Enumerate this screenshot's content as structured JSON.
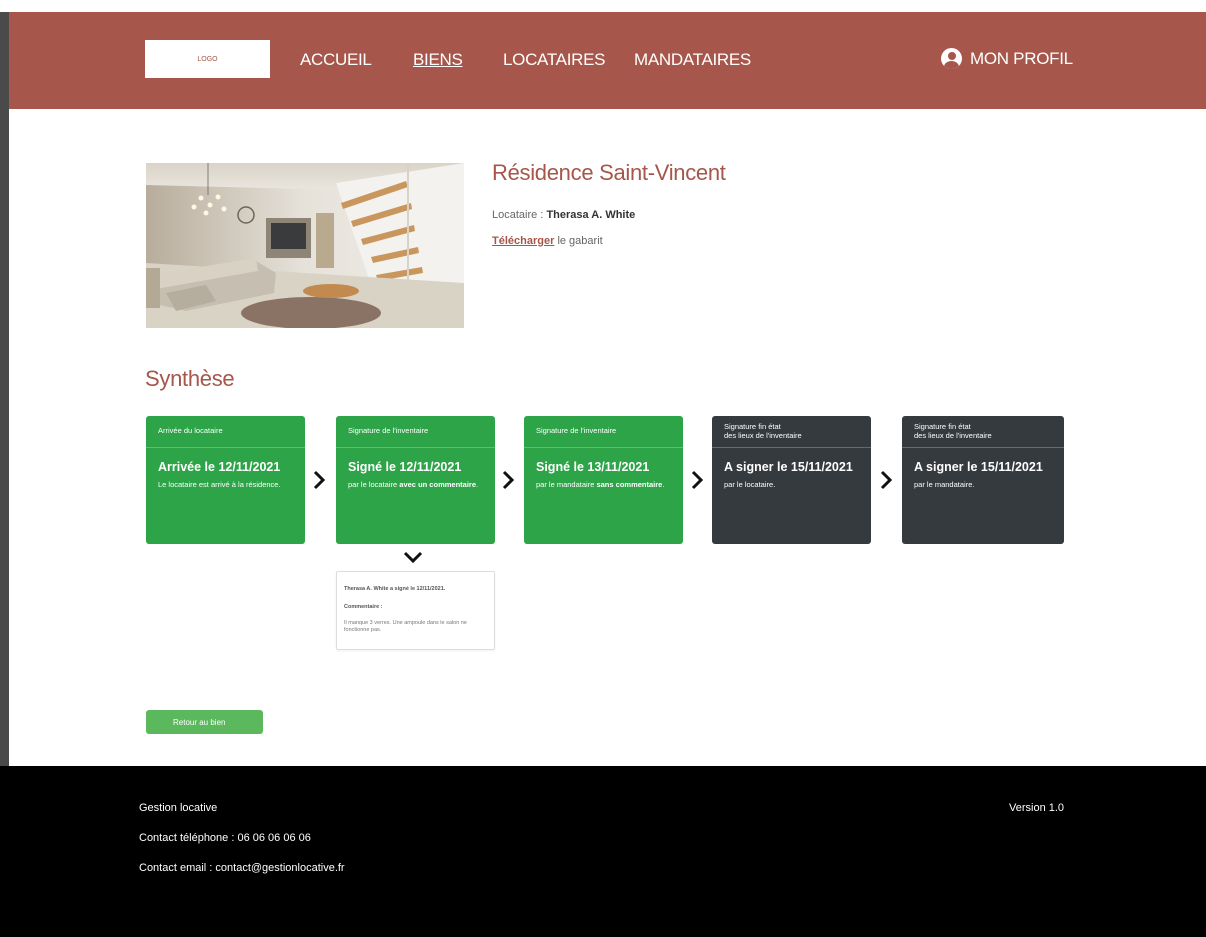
{
  "header": {
    "logo_text": "LOGO",
    "nav": [
      {
        "label": "ACCUEIL",
        "active": false
      },
      {
        "label": "BIENS",
        "active": true
      },
      {
        "label": "LOCATAIRES",
        "active": false
      },
      {
        "label": "MANDATAIRES",
        "active": false
      }
    ],
    "profile_label": "MON PROFIL"
  },
  "property": {
    "title": "Résidence Saint-Vincent",
    "tenant_label": "Locataire :",
    "tenant_name": "Therasa A. White",
    "download_link": "Télécharger",
    "download_suffix": "le gabarit"
  },
  "synthese": {
    "title": "Synthèse",
    "steps": [
      {
        "header": "Arrivée du locataire",
        "main": "Arrivée le 12/11/2021",
        "desc_plain": "Le locataire est arrivé à la résidence.",
        "desc_bold": "",
        "desc_end": "",
        "status": "done"
      },
      {
        "header": "Signature de l'inventaire",
        "main": "Signé le 12/11/2021",
        "desc_plain": "par le locataire",
        "desc_bold": "avec un commentaire",
        "desc_end": ".",
        "status": "done"
      },
      {
        "header": "Signature de l'inventaire",
        "main": "Signé le 13/11/2021",
        "desc_plain": "par le mandataire",
        "desc_bold": "sans commentaire",
        "desc_end": ".",
        "status": "done"
      },
      {
        "header_line1": "Signature fin état",
        "header_line2": "des lieux de l'inventaire",
        "main": "A signer le 15/11/2021",
        "desc_plain": "par le locataire.",
        "status": "pending"
      },
      {
        "header_line1": "Signature fin état",
        "header_line2": "des lieux de l'inventaire",
        "main": "A signer le 15/11/2021",
        "desc_plain": "par le mandataire.",
        "status": "pending"
      }
    ],
    "comment": {
      "signed_line": "Therasa A. White a signé le 12/11/2021.",
      "label": "Commentaire :",
      "text": "Il manque 3 verres. Une ampoule dans le salon ne fonctionne pas."
    },
    "back_button": "Retour au bien"
  },
  "footer": {
    "company": "Gestion locative",
    "phone": "Contact téléphone : 06 06 06 06 06",
    "email": "Contact email : contact@gestionlocative.fr",
    "version": "Version 1.0"
  },
  "colors": {
    "brand": "#a6564a",
    "done": "#2da448",
    "pending": "#353a3f",
    "button": "#5cb85c",
    "footer": "#000000"
  }
}
